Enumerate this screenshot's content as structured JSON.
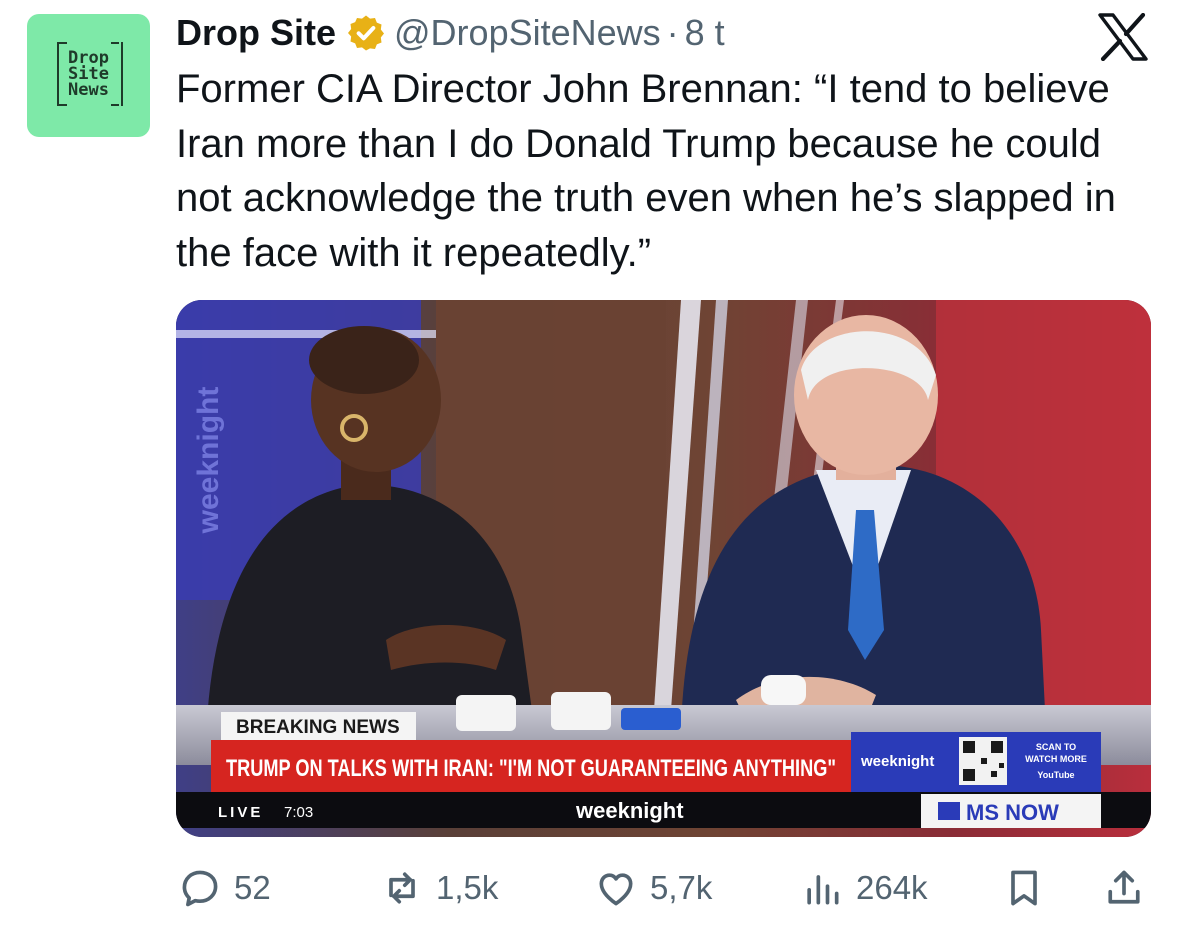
{
  "account": {
    "avatar_text": "Drop\nSite\nNews",
    "display_name": "Drop Site",
    "handle": "@DropSiteNews",
    "separator": "·",
    "time": "8 t"
  },
  "post": {
    "text": "Former CIA Director John Brennan: “I tend to believe Iran more than I do Donald Trump because he could not acknowledge the truth even when he’s slapped in the face with it repeatedly.”"
  },
  "media": {
    "breaking_label": "BREAKING NEWS",
    "headline": "TRUMP ON TALKS WITH IRAN: \"I'M NOT GUARANTEEING ANYTHING\"",
    "live_label": "LIVE",
    "live_time": "7:03",
    "show_logo": "weeknight",
    "show_logo_small": "weeknight",
    "side_text": "weeknight",
    "qr_caption_1": "SCAN TO",
    "qr_caption_2": "WATCH MORE",
    "youtube_label": "YouTube",
    "network": "MS NOW"
  },
  "stats": {
    "replies": "52",
    "reposts": "1,5k",
    "likes": "5,7k",
    "views": "264k"
  },
  "colors": {
    "avatar_bg": "#7ee9a8",
    "verified_badge": "#e8b116",
    "text_primary": "#0f1419",
    "text_secondary": "#536471",
    "breaking_red": "#d62520"
  }
}
